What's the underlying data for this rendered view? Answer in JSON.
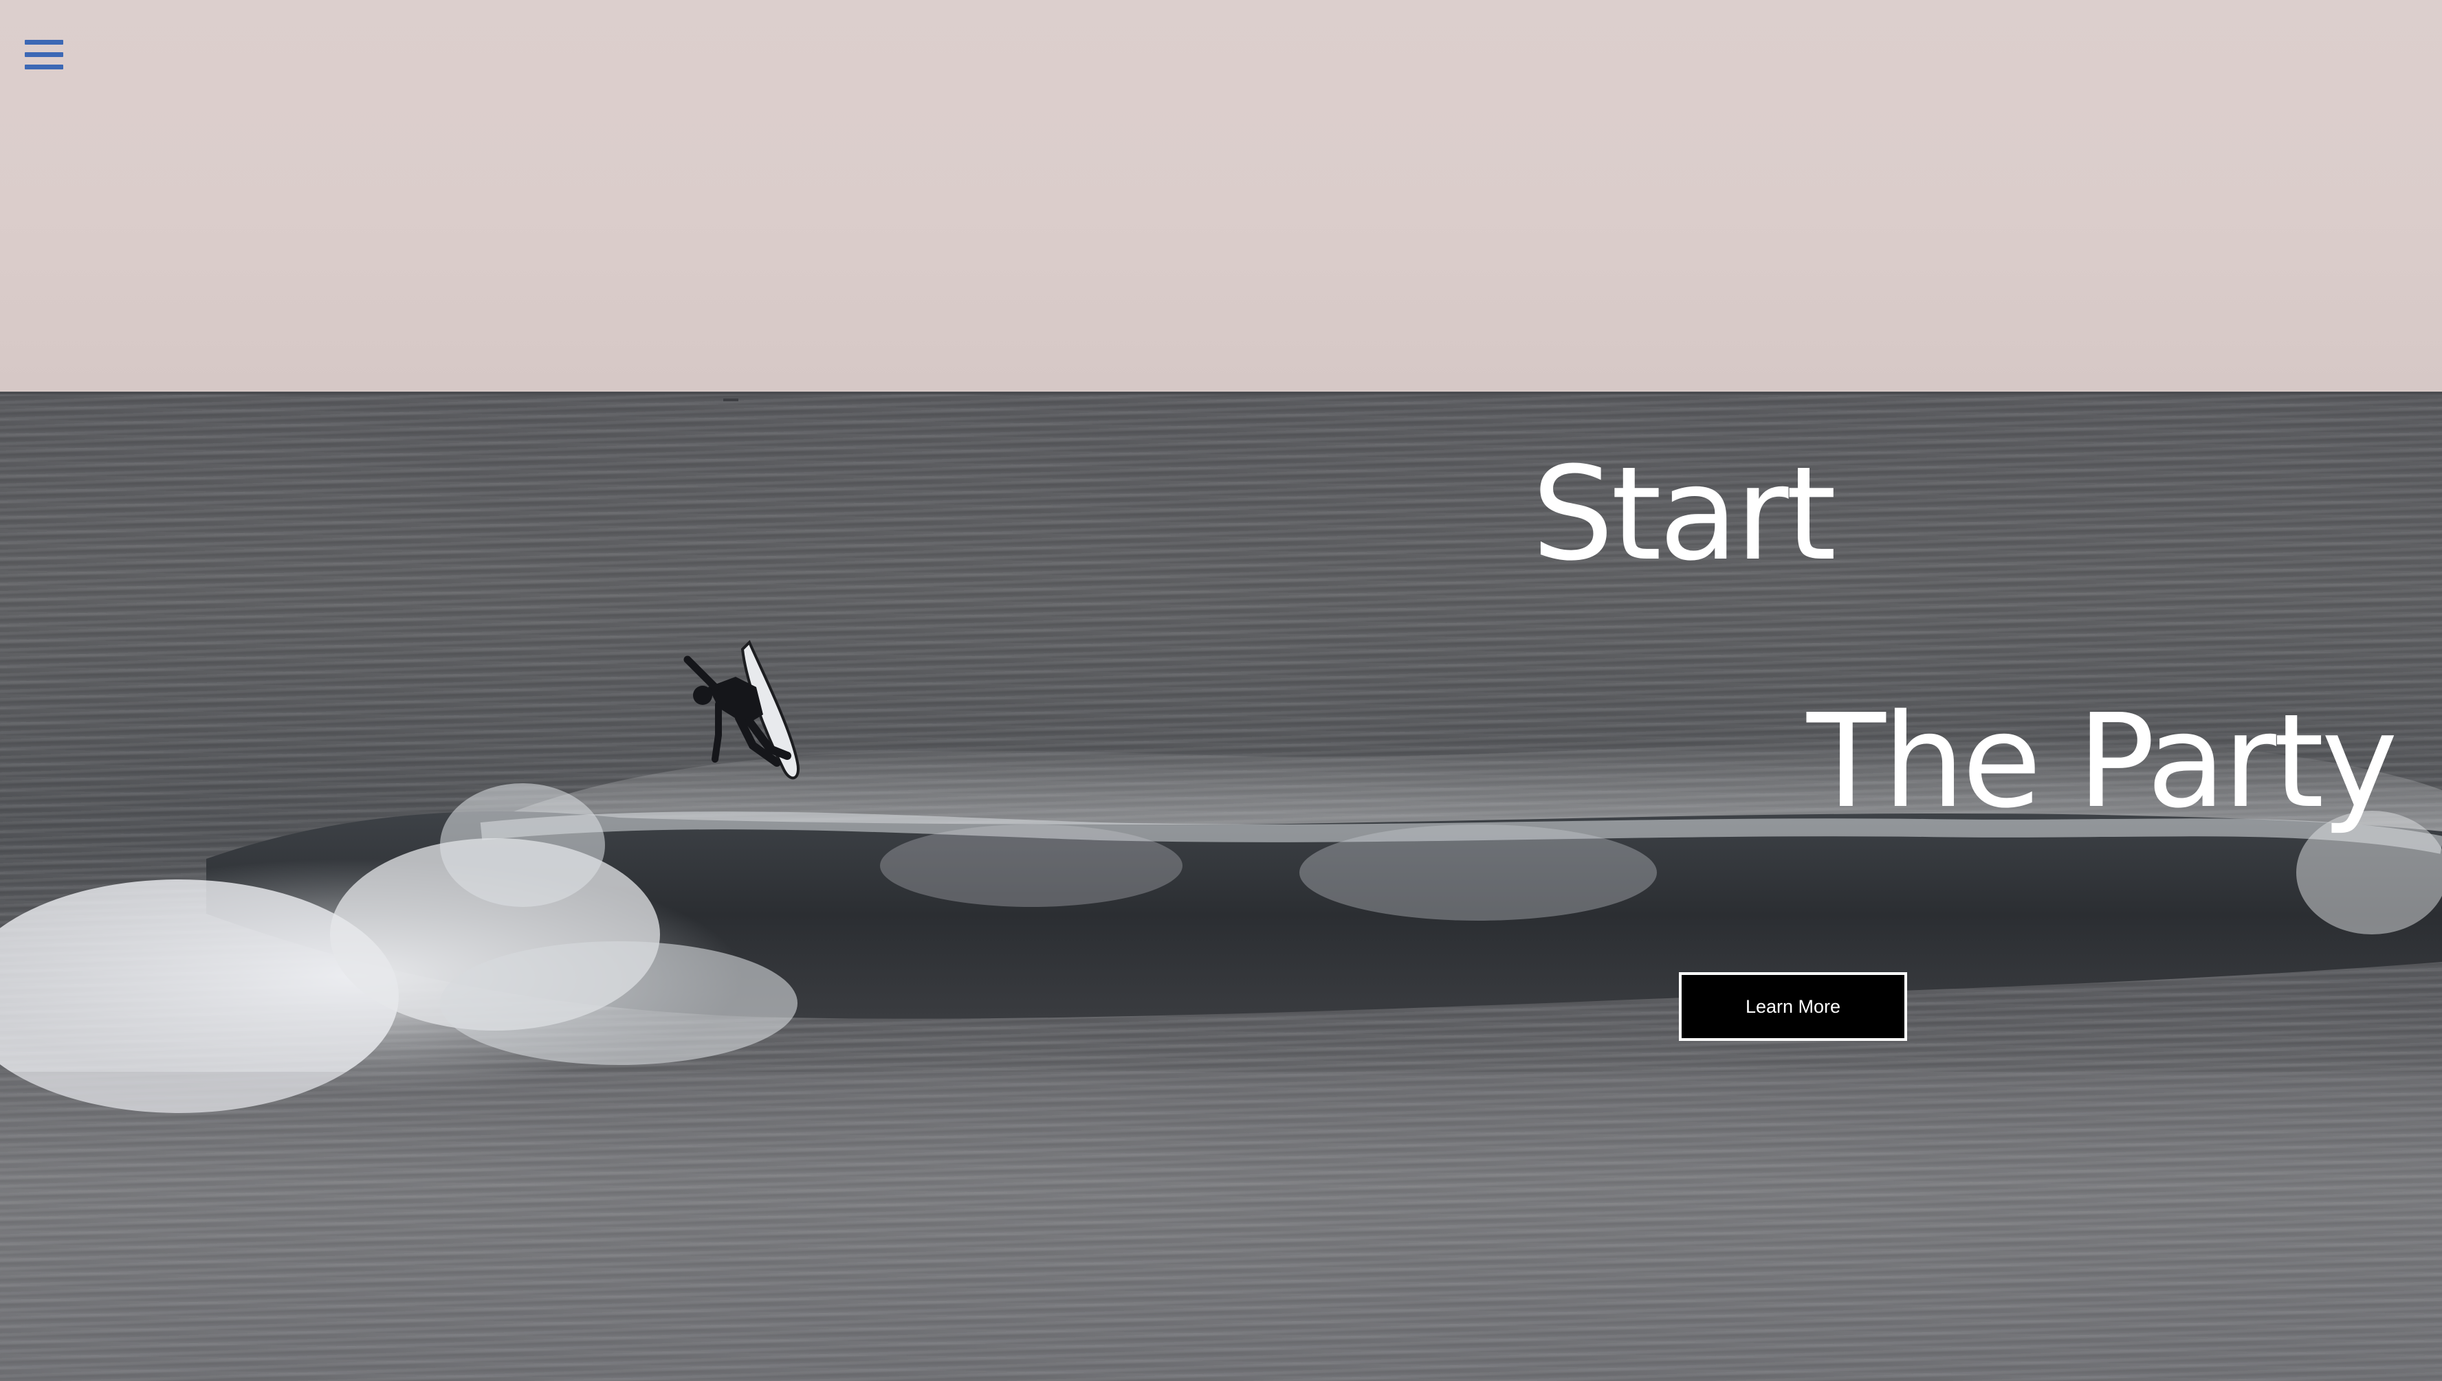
{
  "hero": {
    "headline_line_1": "Start",
    "headline_line_2": "The Party",
    "cta_label": "Learn More"
  },
  "nav": {
    "menu_icon": "hamburger-menu-icon"
  },
  "colors": {
    "menu_icon": "#3c68b5",
    "headline": "#ffffff",
    "cta_background": "#000000",
    "cta_border": "#ffffff",
    "cta_text": "#ffffff"
  }
}
